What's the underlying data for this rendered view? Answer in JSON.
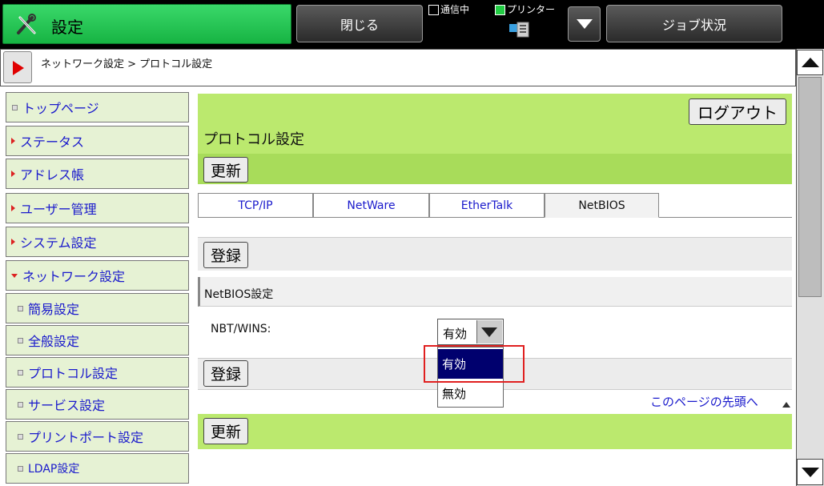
{
  "header": {
    "title": "設定",
    "close_label": "閉じる",
    "comm_label": "通信中",
    "printer_label": "プリンター",
    "job_status_label": "ジョブ状況"
  },
  "breadcrumb": {
    "text": "ネットワーク設定 > プロトコル設定"
  },
  "sidebar": {
    "items": [
      {
        "label": "トップページ"
      },
      {
        "label": "ステータス"
      },
      {
        "label": "アドレス帳"
      },
      {
        "label": "ユーザー管理"
      },
      {
        "label": "システム設定"
      },
      {
        "label": "ネットワーク設定"
      },
      {
        "label": "簡易設定"
      },
      {
        "label": "全般設定"
      },
      {
        "label": "プロトコル設定"
      },
      {
        "label": "サービス設定"
      },
      {
        "label": "プリントポート設定"
      },
      {
        "label": "LDAP設定"
      }
    ]
  },
  "main": {
    "logout_label": "ログアウト",
    "page_title": "プロトコル設定",
    "update_label": "更新",
    "register_label": "登録",
    "tabs": [
      {
        "label": "TCP/IP"
      },
      {
        "label": "NetWare"
      },
      {
        "label": "EtherTalk"
      },
      {
        "label": "NetBIOS"
      }
    ],
    "section_title": "NetBIOS設定",
    "nbt_wins_label": "NBT/WINS:",
    "nbt_wins_value": "有効",
    "nbt_wins_options": [
      "有効",
      "無効"
    ],
    "top_link": "このページの先頭へ"
  },
  "colors": {
    "title_green": "#2ac456",
    "header_green": "#bbe96e",
    "sidebar_bg": "#e6f2d4",
    "link_blue": "#1a1acc",
    "selected_option": "#00006e",
    "highlight_red": "#e02020"
  }
}
